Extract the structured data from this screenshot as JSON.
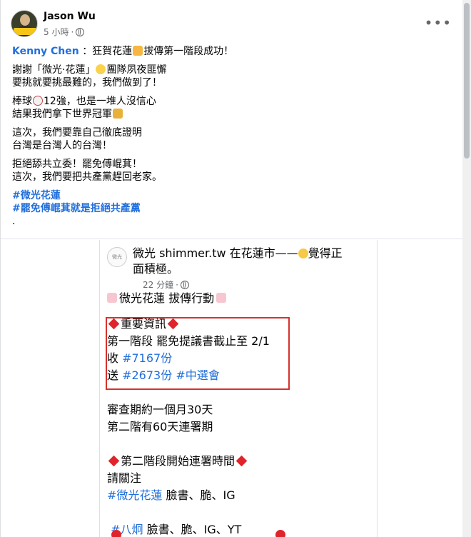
{
  "post": {
    "author": "Jason Wu",
    "time": "5 小時",
    "separator": "·",
    "more_label": "•••",
    "mention": "Kenny Chen",
    "line1_rest": "：狂賀花蓮",
    "line1_end": "拔傳第一階段成功！",
    "line2_a": "謝謝「微光·花蓮」",
    "line2_b": "團隊夙夜匪懈",
    "line3": "要挑就要挑最難的，我們做到了！",
    "line4_a": "棒球",
    "line4_b": "12強，也是一堆人沒信心",
    "line5": "結果我們拿下世界冠軍",
    "line6": "這次，我們要靠自己徹底證明",
    "line7": "台灣是台灣人的台灣！",
    "line8": "拒絕舔共立委！罷免傅崐萁！",
    "line9": "這次，我們要把共產黨趕回老家。",
    "hashtag1": "#微光花蓮",
    "hashtag2": "#罷免傅崐萁就是拒絕共產黨",
    "trailing": ".",
    "icons": [
      "globe-icon",
      "more-icon",
      "thumbs-up-icon",
      "sparkle-icon",
      "baseball-icon",
      "trophy-icon"
    ]
  },
  "shot": {
    "avatar_text": "微光",
    "title_a": "微光 shimmer.tw 在花蓮市——",
    "title_b": "覺得正",
    "title_c": "面積極。",
    "time": "22 分鐘",
    "separator": "·",
    "heading": "微光花蓮 拔傳行動",
    "important": "重要資訊",
    "stage1": "第一階段 罷免提議書截止至 2/1",
    "recv_label": "收 ",
    "recv_value": "#7167份",
    "send_label": "送 ",
    "send_value": "#2673份",
    "send_tag": "#中選會",
    "review": "審查期約一個月30天",
    "stage2": "第二階有60天連署期",
    "stage2_start": "第二階段開始連署時間",
    "follow": "請關注",
    "tag_a": "#微光花蓮",
    "tag_a_rest": " 臉書、脆、IG",
    "tag_b": "#八炯",
    "tag_b_rest": " 臉書、脆、IG、YT"
  },
  "colors": {
    "link": "#216fdb",
    "highlight": "#d6322c",
    "diamond": "#e0242b",
    "meta": "#65676b"
  }
}
